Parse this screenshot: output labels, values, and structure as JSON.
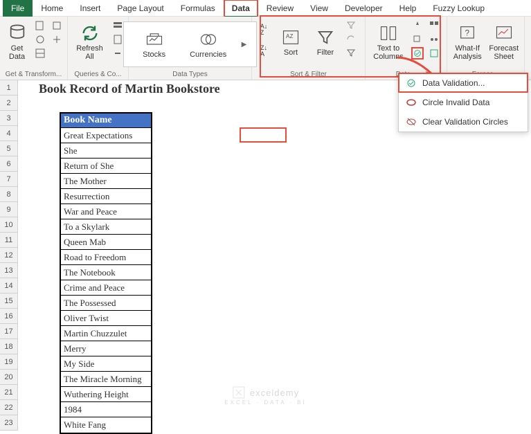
{
  "menu": {
    "file": "File",
    "home": "Home",
    "insert": "Insert",
    "pagelayout": "Page Layout",
    "formulas": "Formulas",
    "data": "Data",
    "review": "Review",
    "view": "View",
    "developer": "Developer",
    "help": "Help",
    "fuzzy": "Fuzzy Lookup"
  },
  "ribbon": {
    "getdata": "Get\nData",
    "refresh": "Refresh\nAll",
    "stocks": "Stocks",
    "currencies": "Currencies",
    "sort": "Sort",
    "filter": "Filter",
    "textcols": "Text to\nColumns",
    "whatif": "What-If\nAnalysis",
    "forecast": "Forecast\nSheet",
    "g1": "Get & Transform...",
    "g2": "Queries & Co...",
    "g3": "Data Types",
    "g4": "Sort & Filter",
    "g5": "Data...",
    "g6": "Foreca..."
  },
  "dropdown": {
    "dv": "Data Validation...",
    "circle": "Circle Invalid Data",
    "clear": "Clear Validation Circles"
  },
  "sheet": {
    "title": "Book Record of Martin Bookstore",
    "header": "Book Name",
    "books": [
      "Great Expectations",
      "She",
      "Return of She",
      "The Mother",
      "Resurrection",
      "War and Peace",
      "To a Skylark",
      "Queen Mab",
      "Road to Freedom",
      "The Notebook",
      "Crime and Peace",
      "The Possessed",
      "Oliver Twist",
      "Martin Chuzzulet",
      "Merry",
      "My Side",
      "The Miracle Morning",
      "Wuthering Height",
      "1984",
      "White Fang"
    ]
  },
  "watermark": {
    "main": "exceldemy",
    "sub": "EXCEL · DATA · BI"
  }
}
